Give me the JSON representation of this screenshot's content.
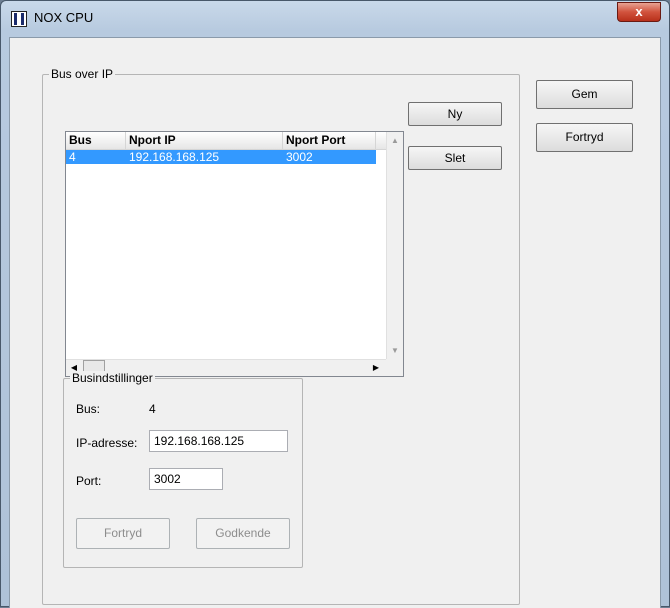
{
  "window": {
    "title": "NOX CPU",
    "close_label": "x",
    "app_icon": "app-columns-icon",
    "close_icon": "close-icon"
  },
  "bus_group": {
    "label": "Bus over IP",
    "columns": [
      "Bus",
      "Nport IP",
      "Nport Port"
    ],
    "rows": [
      {
        "bus": "4",
        "ip": "192.168.168.125",
        "port": "3002"
      }
    ],
    "selected_row_color": "#3399ff"
  },
  "buttons": {
    "ny": "Ny",
    "slet": "Slet",
    "gem": "Gem",
    "fortryd": "Fortryd"
  },
  "settings_group": {
    "label": "Busindstillinger",
    "bus_label": "Bus:",
    "bus_value": "4",
    "ip_label": "IP-adresse:",
    "ip_value": "192.168.168.125",
    "port_label": "Port:",
    "port_value": "3002",
    "cancel_label": "Fortryd",
    "approve_label": "Godkende"
  }
}
